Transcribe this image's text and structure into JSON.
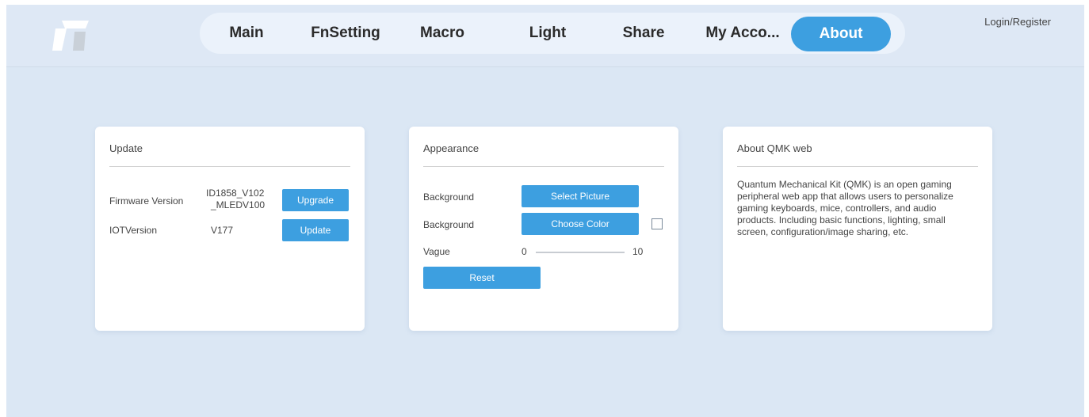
{
  "header": {
    "nav": [
      {
        "label": "Main"
      },
      {
        "label": "FnSetting"
      },
      {
        "label": "Macro"
      },
      {
        "label": "Light"
      },
      {
        "label": "Share"
      },
      {
        "label": "My Acco..."
      },
      {
        "label": "About",
        "active": true
      }
    ],
    "login_label": "Login/Register",
    "logo_icon": "app-logo-icon"
  },
  "update": {
    "title": "Update",
    "firmware_label": "Firmware Version",
    "firmware_value_line1": "ID1858_V102",
    "firmware_value_line2": "_MLEDV100",
    "upgrade_label": "Upgrade",
    "iot_label": "IOTVersion",
    "iot_value": "V177",
    "update_label": "Update"
  },
  "appearance": {
    "title": "Appearance",
    "background_label_1": "Background",
    "select_picture_label": "Select Picture",
    "background_label_2": "Background",
    "choose_color_label": "Choose Color",
    "vague_label": "Vague",
    "vague_min": "0",
    "vague_max": "10",
    "reset_label": "Reset"
  },
  "about": {
    "title": "About QMK web",
    "description": "Quantum Mechanical Kit (QMK) is an open gaming peripheral web app that allows users to personalize gaming keyboards, mice, controllers, and audio products. Including basic functions, lighting, small screen, configuration/image sharing, etc."
  },
  "colors": {
    "accent": "#3d9fe0",
    "page_background": "#dbe7f4",
    "nav_background": "#ebf2fb",
    "card_background": "#ffffff"
  }
}
